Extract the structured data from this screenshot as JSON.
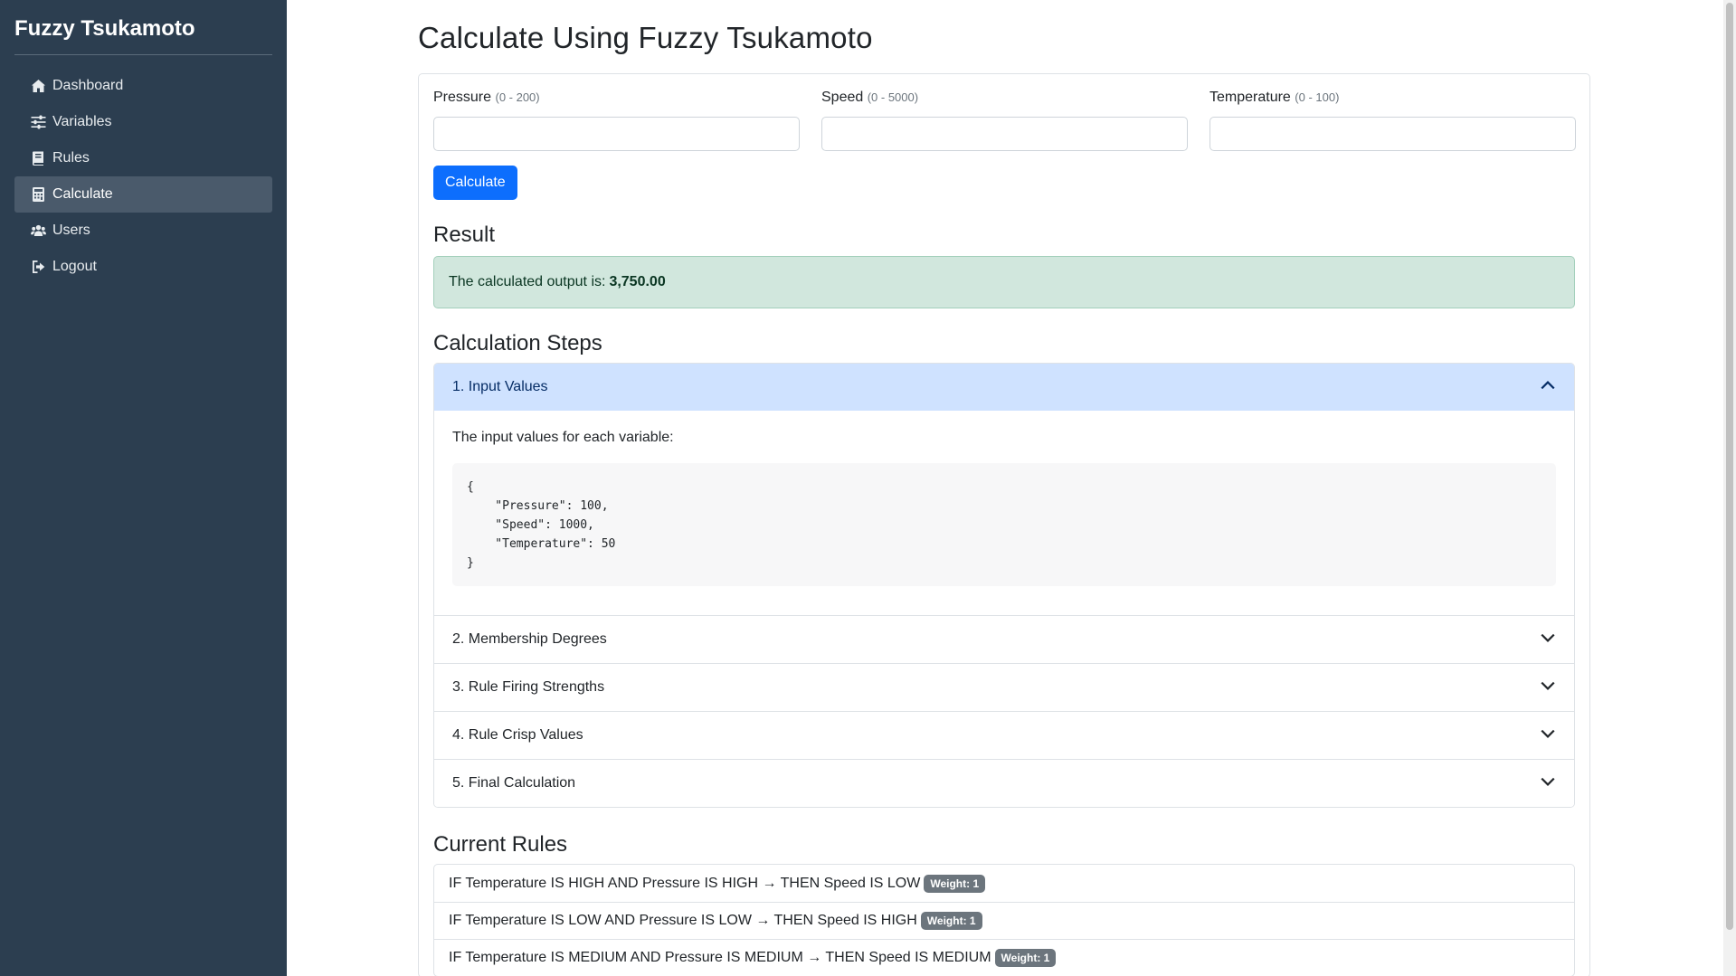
{
  "sidebar": {
    "brand": "Fuzzy Tsukamoto",
    "items": [
      {
        "label": "Dashboard",
        "icon": "home-icon",
        "active": false
      },
      {
        "label": "Variables",
        "icon": "sliders-icon",
        "active": false
      },
      {
        "label": "Rules",
        "icon": "book-icon",
        "active": false
      },
      {
        "label": "Calculate",
        "icon": "calculator-icon",
        "active": true
      },
      {
        "label": "Users",
        "icon": "users-icon",
        "active": false
      },
      {
        "label": "Logout",
        "icon": "logout-icon",
        "active": false
      }
    ]
  },
  "main": {
    "title": "Calculate Using Fuzzy Tsukamoto",
    "inputs": [
      {
        "label": "Pressure",
        "range": "(0 - 200)",
        "value": ""
      },
      {
        "label": "Speed",
        "range": "(0 - 5000)",
        "value": ""
      },
      {
        "label": "Temperature",
        "range": "(0 - 100)",
        "value": ""
      }
    ],
    "calculate_button": "Calculate",
    "result": {
      "title": "Result",
      "text": "The calculated output is:",
      "value": "3,750.00"
    },
    "steps": {
      "title": "Calculation Steps",
      "items": [
        {
          "label": "1. Input Values",
          "open": true
        },
        {
          "label": "2. Membership Degrees",
          "open": false
        },
        {
          "label": "3. Rule Firing Strengths",
          "open": false
        },
        {
          "label": "4. Rule Crisp Values",
          "open": false
        },
        {
          "label": "5. Final Calculation",
          "open": false
        }
      ],
      "input_values_desc": "The input values for each variable:",
      "input_values_json": "{\n    \"Pressure\": 100,\n    \"Speed\": 1000,\n    \"Temperature\": 50\n}"
    },
    "rules": {
      "title": "Current Rules",
      "items": [
        {
          "text": "IF Temperature IS HIGH AND Pressure IS HIGH → THEN Speed IS LOW",
          "badge": "Weight: 1"
        },
        {
          "text": "IF Temperature IS LOW AND Pressure IS LOW → THEN Speed IS HIGH",
          "badge": "Weight: 1"
        },
        {
          "text": "IF Temperature IS MEDIUM AND Pressure IS MEDIUM → THEN Speed IS MEDIUM",
          "badge": "Weight: 1"
        }
      ]
    }
  },
  "colors": {
    "sidebar_bg": "#2c3e50",
    "primary": "#0d6efd",
    "success_bg": "#d1e7dd",
    "accordion_open_bg": "#cfe2ff"
  }
}
